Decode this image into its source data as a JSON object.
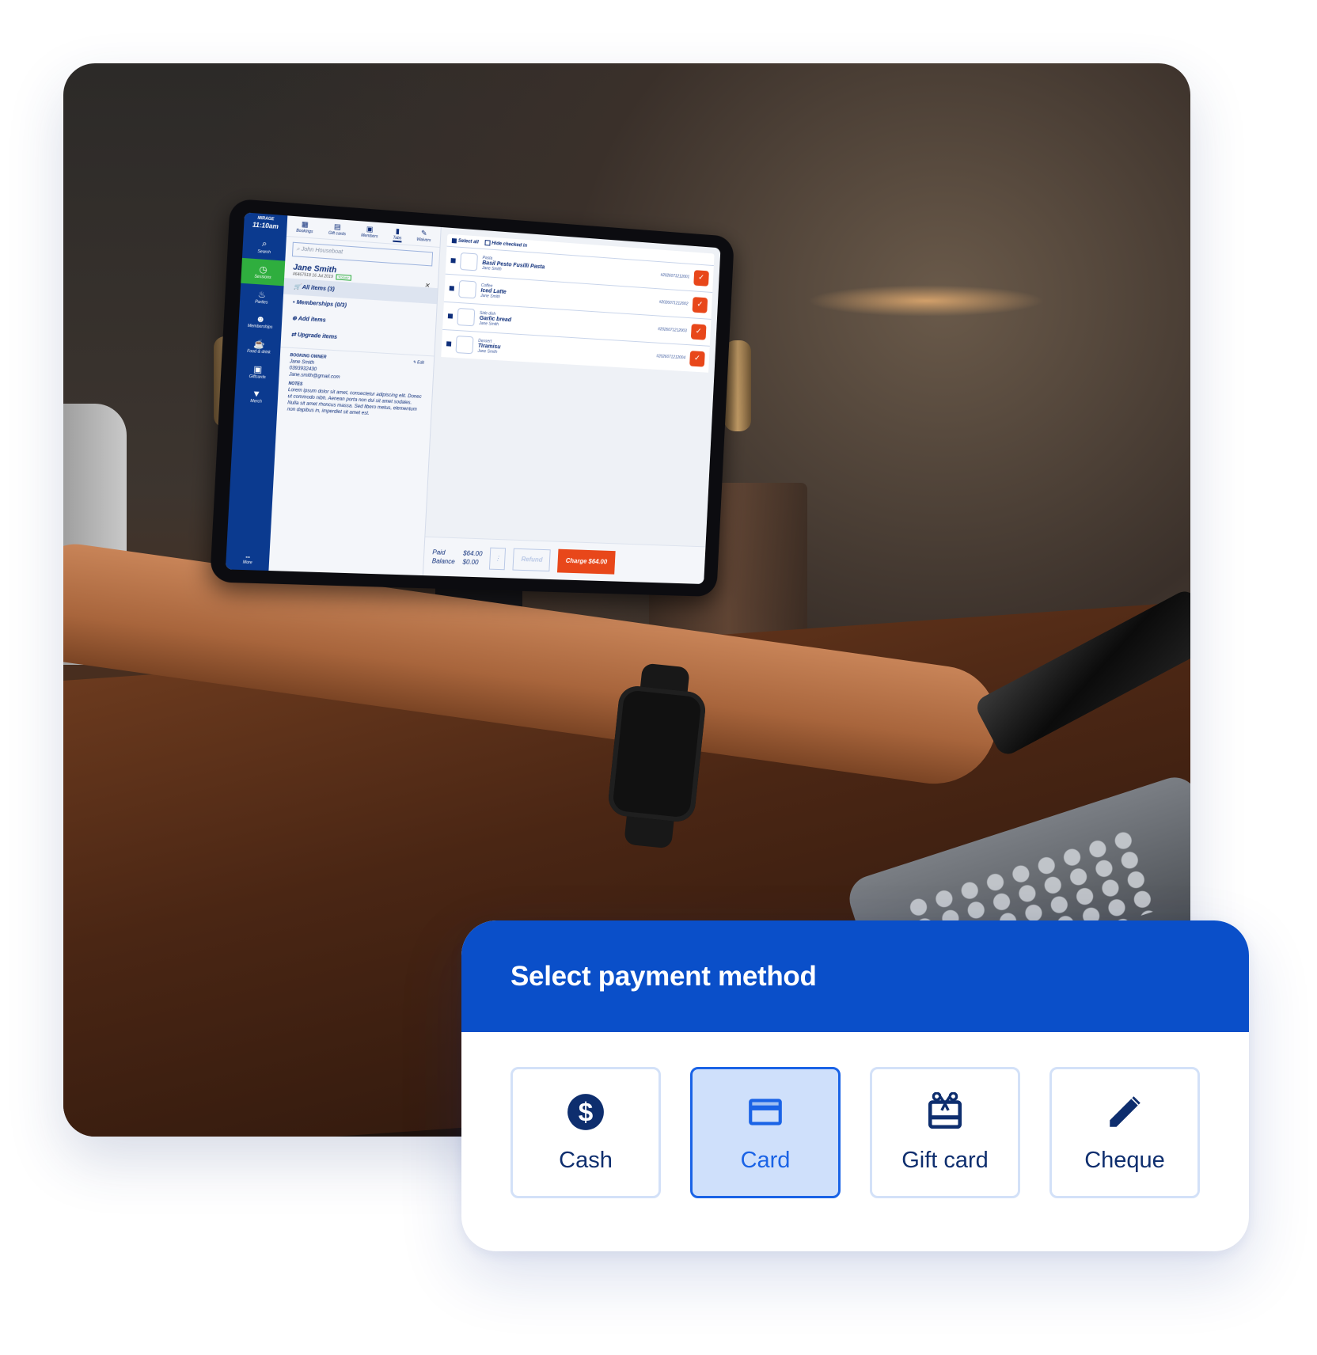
{
  "tablet_app": {
    "brand": "MIRAGE",
    "time": "11:10am",
    "sidebar": [
      {
        "label": "Search",
        "icon": "search-icon",
        "active": false
      },
      {
        "label": "Sessions",
        "icon": "clock-icon",
        "active": true
      },
      {
        "label": "Parties",
        "icon": "cake-icon",
        "active": false
      },
      {
        "label": "Memberships",
        "icon": "people-icon",
        "active": false
      },
      {
        "label": "Food & drink",
        "icon": "food-icon",
        "active": false
      },
      {
        "label": "Giftcards",
        "icon": "gift-icon",
        "active": false
      },
      {
        "label": "Merch",
        "icon": "shirt-icon",
        "active": false
      }
    ],
    "more_label": "More",
    "tabs": [
      {
        "label": "Bookings",
        "icon": "calendar-icon"
      },
      {
        "label": "Gift cards",
        "icon": "giftcard-icon"
      },
      {
        "label": "Members",
        "icon": "member-icon"
      },
      {
        "label": "Tabs",
        "icon": "tab-icon",
        "active": true
      },
      {
        "label": "Waivers",
        "icon": "pen-icon"
      }
    ],
    "search_placeholder": "John Houseboat",
    "customer": {
      "name": "Jane Smith",
      "id": "#6467518",
      "date": "16 Jul 2019",
      "badge": "TODAY"
    },
    "menu": [
      {
        "label": "All items (3)",
        "active": true
      },
      {
        "label": "Memberships (0/3)"
      },
      {
        "label": "Add items"
      },
      {
        "label": "Upgrade items"
      }
    ],
    "booking_owner": {
      "heading": "BOOKING OWNER",
      "edit_label": "Edit",
      "name": "Jane Smith",
      "phone": "0393932430",
      "email": "Jane.smith@gmail.com"
    },
    "notes": {
      "heading": "NOTES",
      "text": "Lorem ipsum dolor sit amet, consectetur adipiscing elit. Donec ut commodo nibh. Aenean porta non dui sit amet sodales. Nulla sit amet rhoncus massa. Sed libero metus, elementum non dapibus in, imperdiet sit amet est."
    },
    "list_controls": {
      "select_all": "Select all",
      "hide_checked_in": "Hide checked in"
    },
    "items": [
      {
        "category": "Pasta",
        "name": "Basil Pesto Fusilli Pasta",
        "owner": "Jane Smith",
        "id": "#2026071212001"
      },
      {
        "category": "Coffee",
        "name": "Iced Latte",
        "owner": "Jane Smith",
        "id": "#2026071212002"
      },
      {
        "category": "Side dish",
        "name": "Garlic bread",
        "owner": "Jane Smith",
        "id": "#2026071212003"
      },
      {
        "category": "Dessert",
        "name": "Tiramisu",
        "owner": "Jane Smith",
        "id": "#2026071212004"
      }
    ],
    "footer": {
      "paid_label": "Paid",
      "paid_value": "$64.00",
      "balance_label": "Balance",
      "balance_value": "$0.00",
      "refund_label": "Refund",
      "charge_label": "Charge $64.00"
    }
  },
  "payment_dialog": {
    "title": "Select payment method",
    "accent_color": "#0a4fc9",
    "selected": "Card",
    "options": [
      {
        "label": "Cash",
        "icon": "dollar-circle-icon"
      },
      {
        "label": "Card",
        "icon": "credit-card-icon"
      },
      {
        "label": "Gift card",
        "icon": "gift-card-icon"
      },
      {
        "label": "Cheque",
        "icon": "pencil-icon"
      }
    ]
  }
}
